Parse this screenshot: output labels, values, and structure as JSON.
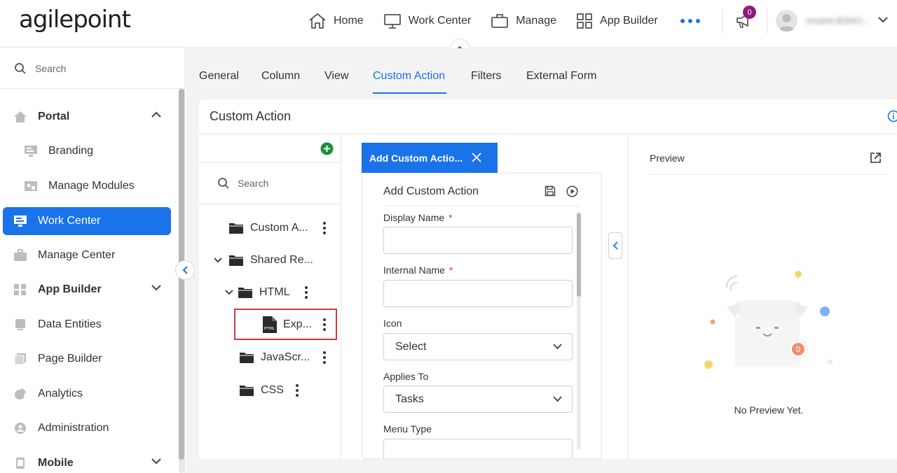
{
  "brand": {
    "logo_text": "agilepoint"
  },
  "topnav": {
    "items": [
      {
        "label": "Home",
        "icon": "home-icon"
      },
      {
        "label": "Work Center",
        "icon": "monitor-icon"
      },
      {
        "label": "Manage",
        "icon": "briefcase-icon"
      },
      {
        "label": "App Builder",
        "icon": "grid-icon"
      }
    ],
    "more_icon": "more-dots-icon",
    "notification_count": "0",
    "user_name": "rmuirel.BSNO..."
  },
  "sidebar": {
    "search_placeholder": "Search",
    "items": [
      {
        "label": "Portal",
        "icon": "home-icon",
        "expanded": true
      },
      {
        "label": "Branding",
        "icon": "branding-icon"
      },
      {
        "label": "Manage Modules",
        "icon": "modules-icon"
      },
      {
        "label": "Work Center",
        "icon": "monitor-icon",
        "active": true
      },
      {
        "label": "Manage Center",
        "icon": "briefcase-icon"
      },
      {
        "label": "App Builder",
        "icon": "grid-icon",
        "expanded": false
      },
      {
        "label": "Data Entities",
        "icon": "database-icon"
      },
      {
        "label": "Page Builder",
        "icon": "pages-icon"
      },
      {
        "label": "Analytics",
        "icon": "pie-icon"
      },
      {
        "label": "Administration",
        "icon": "admin-icon"
      },
      {
        "label": "Mobile",
        "icon": "mobile-icon",
        "expanded": false
      }
    ]
  },
  "tabs": [
    {
      "label": "General"
    },
    {
      "label": "Column"
    },
    {
      "label": "View"
    },
    {
      "label": "Custom Action",
      "active": true
    },
    {
      "label": "Filters"
    },
    {
      "label": "External Form"
    }
  ],
  "panel": {
    "title": "Custom Action",
    "tree": {
      "search_placeholder": "Search",
      "nodes": [
        {
          "label": "Custom A...",
          "type": "folder"
        },
        {
          "label": "Shared Re...",
          "type": "folder",
          "expanded": true
        },
        {
          "label": "HTML",
          "type": "folder",
          "expanded": true
        },
        {
          "label": "Exp...",
          "type": "html-file",
          "selected": true,
          "file_badge": "HTML"
        },
        {
          "label": "JavaScr...",
          "type": "folder"
        },
        {
          "label": "CSS",
          "type": "folder"
        }
      ]
    },
    "form": {
      "tab_label": "Add Custom Actio...",
      "title": "Add Custom Action",
      "fields": [
        {
          "label": "Display Name",
          "required": true,
          "value": ""
        },
        {
          "label": "Internal Name",
          "required": true,
          "value": ""
        },
        {
          "label": "Icon",
          "type": "select",
          "value": "Select"
        },
        {
          "label": "Applies To",
          "type": "select",
          "value": "Tasks"
        },
        {
          "label": "Menu Type",
          "type": "select",
          "value": ""
        }
      ],
      "required_marker": "*"
    },
    "preview": {
      "title": "Preview",
      "empty_text": "No Preview Yet.",
      "illustration_badge": "0"
    }
  },
  "colors": {
    "accent": "#1a73e8",
    "required": "#d9363e",
    "highlight": "#d9363e",
    "badge": "#8e1a7c"
  }
}
